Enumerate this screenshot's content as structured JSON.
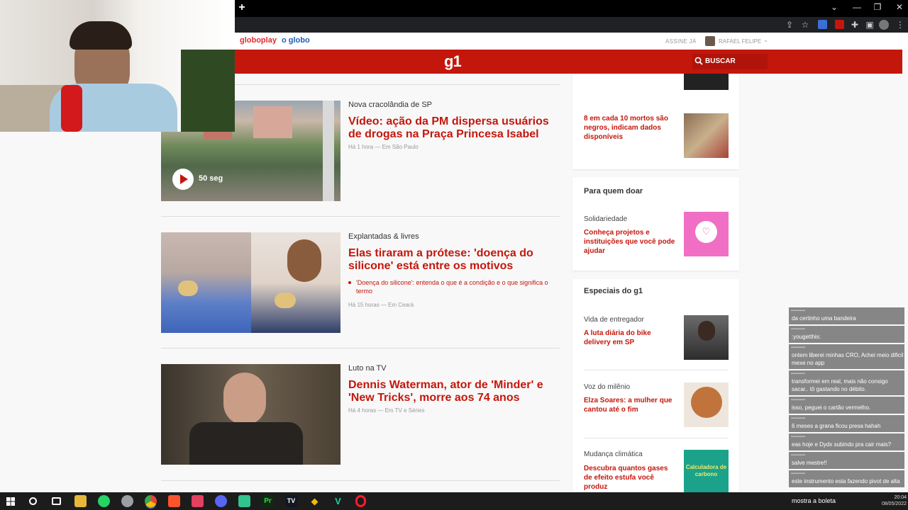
{
  "browser": {
    "new_tab": "+",
    "window_controls": [
      "⌄",
      "—",
      "❐",
      "✕"
    ]
  },
  "site": {
    "links": {
      "globoplay": "globoplay",
      "oglobo": "o globo"
    },
    "subscribe": "ASSINE JÁ",
    "user_name": "RAFAEL FELIPE",
    "logo": "g1",
    "search_label": "BUSCAR",
    "colors": {
      "brand_red": "#c4170c",
      "globoplay": "#e5292b",
      "oglobo": "#1c5fb5"
    }
  },
  "feed": [
    {
      "kicker": "Nova cracolândia de SP",
      "headline": "Vídeo: ação da PM dispersa usuários de drogas na Praça Princesa Isabel",
      "meta": "Há 1 hora — Em São Paulo",
      "video_duration": "50 seg"
    },
    {
      "kicker": "Explantadas & livres",
      "headline": "Elas tiraram a prótese: 'doença do silicone' está entre os motivos",
      "related": "'Doença do silicone': entenda o que é a condição e o que significa o termo",
      "meta": "Há 15 horas — Em Ceará"
    },
    {
      "kicker": "Luto na TV",
      "headline": "Dennis Waterman, ator de 'Minder' e 'New Tricks', morre aos 74 anos",
      "meta": "Há 4 horas — Em TV e Séries"
    }
  ],
  "sidebar": {
    "top_card": {
      "headline": "8 em cada 10 mortos são negros, indicam dados disponíveis"
    },
    "donate_card": {
      "title": "Para quem doar",
      "kicker": "Solidariedade",
      "headline": "Conheça projetos e instituições que você pode ajudar"
    },
    "specials_card": {
      "title": "Especiais do g1",
      "items": [
        {
          "kicker": "Vida de entregador",
          "headline": "A luta diária do bike delivery em SP"
        },
        {
          "kicker": "Voz do milênio",
          "headline": "Elza Soares: a mulher que cantou até o fim"
        },
        {
          "kicker": "Mudança climática",
          "headline": "Descubra quantos gases de efeito estufa você produz",
          "thumb_text": "Calculadora de carbono"
        }
      ]
    }
  },
  "chat": [
    "da certinho uma bandeira",
    ":yougetthis:",
    "ontem liberei minhas CRO, Achei meio dificil mexe no app",
    "transformei em real, mais não consigo sacar.. tô gastando no débito.",
    "isso, peguei o cartão vermelho.",
    "6 meses a grana ficou presa hahah",
    "eas hoje e Dydx subindo pra cair mais?",
    "salve mestre!!",
    "este instrumento esta fazendo pivot de alta",
    "mostra a boleta"
  ],
  "taskbar": {
    "clock_time": "20:04",
    "clock_date": "08/05/2022"
  }
}
